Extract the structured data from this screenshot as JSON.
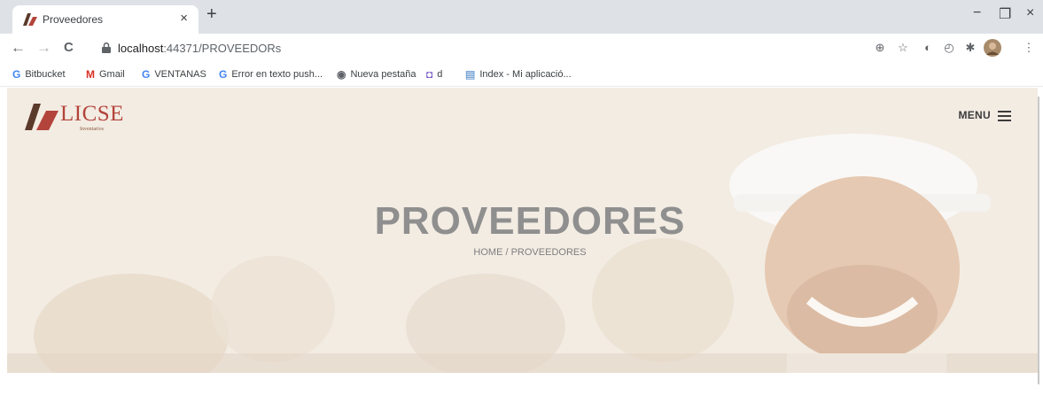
{
  "browser": {
    "tab_title": "Proveedores",
    "tab_close": "×",
    "new_tab": "+",
    "url_host": "localhost",
    "url_path": ":44371/PROVEEDORs",
    "window_controls": {
      "minimize": "−",
      "restore": "❐",
      "close": "×"
    },
    "nav": {
      "back": "←",
      "forward": "→",
      "reload": "C"
    }
  },
  "bookmarks": [
    {
      "label": "Bitbucket",
      "icon": "google-icon",
      "glyph": "G",
      "color": "#4285f4"
    },
    {
      "label": "Gmail",
      "icon": "gmail-icon",
      "glyph": "M",
      "color": "#d93025"
    },
    {
      "label": "VENTANAS",
      "icon": "google-icon",
      "glyph": "G",
      "color": "#4285f4"
    },
    {
      "label": "Error en texto push...",
      "icon": "google-icon",
      "glyph": "G",
      "color": "#4285f4"
    },
    {
      "label": "Nueva pestaña",
      "icon": "globe-icon",
      "glyph": "◉",
      "color": "#5f6368"
    },
    {
      "label": "d",
      "icon": "shield-icon",
      "glyph": "◘",
      "color": "#7a5cc9"
    },
    {
      "label": "Index - Mi aplicació...",
      "icon": "document-icon",
      "glyph": "▤",
      "color": "#7aa7d6"
    }
  ],
  "site": {
    "logo_text": "LICSE",
    "logo_subtitle": "Inventarios",
    "menu_label": "MENU",
    "page_title": "PROVEEDORES",
    "breadcrumb": "HOME / PROVEEDORES"
  },
  "colors": {
    "logo": "#b3443b",
    "hero_overlay": "#f5efe8"
  }
}
